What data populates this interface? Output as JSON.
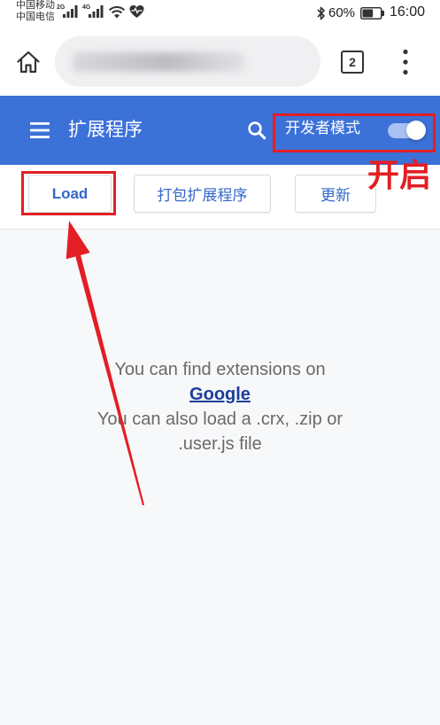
{
  "status_bar": {
    "carrier_top": "中国移动",
    "carrier_bottom": "中国电信",
    "network_top": "2G",
    "network_bottom": "4G",
    "battery_percent": "60%",
    "battery_level": 0.6,
    "time": "16:00"
  },
  "browser_bar": {
    "tab_count": "2"
  },
  "header": {
    "title": "扩展程序",
    "developer_mode_label": "开发者模式",
    "developer_mode_on": true
  },
  "annotation": {
    "callout_text": "开启"
  },
  "toolbar": {
    "load_label": "Load",
    "pack_label": "打包扩展程序",
    "update_label": "更新"
  },
  "empty_state": {
    "line1": "You can find extensions on",
    "link": "Google",
    "line2": "You can also load a .crx, .zip or",
    "line3": ".user.js file"
  },
  "icons": {
    "status": [
      "signal-icon",
      "wifi-icon",
      "heart-rate-icon",
      "bluetooth-icon",
      "battery-icon"
    ],
    "browser": [
      "home-icon",
      "tab-count-icon",
      "more-vert-icon"
    ],
    "header": [
      "menu-icon",
      "search-icon",
      "toggle-switch"
    ]
  },
  "colors": {
    "header_bg": "#3c71d8",
    "accent_red": "#e31e24",
    "button_text": "#3467c9",
    "link": "#1b3d9c",
    "content_bg": "#f7f8fa",
    "toggle_track_on": "#a9c0f3"
  }
}
